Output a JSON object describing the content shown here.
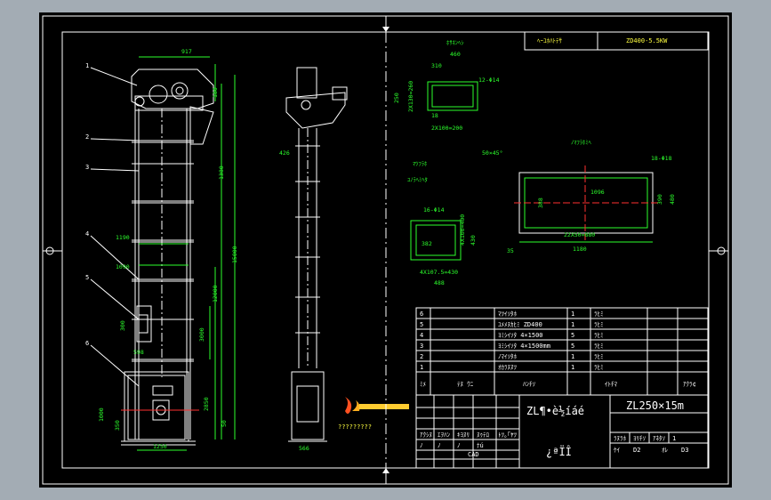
{
  "title_block": {
    "top_right_label": "ﾍｰﾕﾎﾊﾄﾃｻ",
    "top_right_value": "ZD400-5.5KW",
    "main_title": "ZL¶•è½íáé",
    "model": "ZL250×15m",
    "company": "¿ªÏÎ",
    "cad_label": "CAD"
  },
  "balloons": [
    "1",
    "2",
    "3",
    "4",
    "5",
    "6"
  ],
  "dims": {
    "d917": "917",
    "d180": "180",
    "d1380": "1380",
    "d1190": "1190",
    "d1090": "1090",
    "d15000": "15000",
    "d12000": "12000",
    "d3000": "3000",
    "d2850": "2850",
    "d350": "350",
    "d1000": "1000",
    "d598": "598",
    "d1250": "1250",
    "d300": "300",
    "d426": "426",
    "d566": "566",
    "d50": "50",
    "d1750": "1750"
  },
  "section_a": {
    "title": "ﾎｻﾈﾝﾍｼ",
    "d460": "460",
    "d310": "310",
    "d250": "250",
    "left_label": "2X130=260",
    "holes": "12-Φ14",
    "bottom_label": "2X100=200",
    "d18": "18"
  },
  "section_b": {
    "title1": "ﾏﾂﾌﾗﾎ",
    "title2": "ﾕﾉﾗﾍﾐﾍﾀ",
    "holes": "16-Φ14",
    "d382": "382",
    "d476": "476",
    "right_label": "4X100=400",
    "d430": "430",
    "bottom_label": "4X107.5=430",
    "d488": "488"
  },
  "section_c": {
    "title": "ﾉﾏﾌﾗﾎﾐﾍ",
    "chamfer": "50×45°",
    "holes": "18-Φ18",
    "d1096": "1096",
    "d388": "388",
    "d390": "390",
    "d480": "480",
    "bottom_label": "22X50=880",
    "d1180": "1180",
    "d35": "35"
  },
  "parts_table": {
    "rows": [
      {
        "no": "6",
        "name": "ﾏﾂｲｿﾀﾎ",
        "qty": "1",
        "note": "ﾗﾋﾐ"
      },
      {
        "no": "5",
        "name": "ﾕﾒﾒﾇｶﾋﾐ ZD400",
        "qty": "1",
        "note": "ﾗﾋﾐ"
      },
      {
        "no": "4",
        "name": "ﾖﾐｼｲｿﾀ 4×1500",
        "qty": "5",
        "note": "ﾗﾋﾐ"
      },
      {
        "no": "3",
        "name": "ﾖﾐｼｲｿﾀ 4×1500mm",
        "qty": "5",
        "note": "ﾗﾋﾐ"
      },
      {
        "no": "2",
        "name": "ﾉﾏｲｿﾀﾎ",
        "qty": "1",
        "note": "ﾗﾋﾐ"
      },
      {
        "no": "1",
        "name": "ｵｶﾗﾇﾇﾂ",
        "qty": "1",
        "note": "ﾗﾋﾐ"
      }
    ],
    "header": {
      "no": "ﾐﾒ",
      "name": "ﾃﾇ ｳﾆ",
      "qty": "ﾊﾝﾁｿ",
      "material": "ｲﾄﾁﾏ",
      "note": "ｱｸﾗ¢"
    }
  },
  "titleblock_cells": {
    "rev": "ｱｸｼﾇ",
    "label2": "ｴｦﾊﾝ",
    "label3": "ｷﾖﾇﾘ",
    "sign": "ﾇｩﾃﾛ",
    "date": "ﾄﾂ｡｢ﾔﾂ",
    "design": "ﾉ",
    "check": "ﾉ",
    "std": "ﾉ",
    "approve": "ﾅú",
    "stage": "ﾗﾇﾗﾎ",
    "weight": "ﾖﾘﾁｿ",
    "scale": "ｱﾈﾀｿ",
    "d1": "1",
    "d2": "D2",
    "d3": "D3",
    "shts": "ｹｲ",
    "sht": "ｵﾚ"
  },
  "logo": {
    "caption": "?????????"
  }
}
